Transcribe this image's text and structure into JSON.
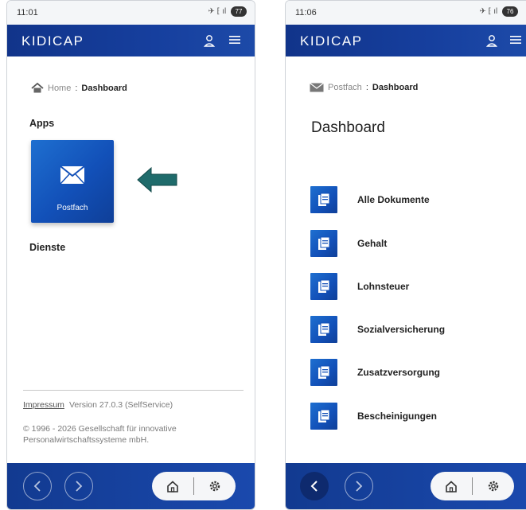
{
  "left_screen": {
    "status": {
      "time": "11:01",
      "icons": "✈ ⁅ ıl",
      "battery": "77"
    },
    "appbar": {
      "brand": "KIDICAP"
    },
    "breadcrumb": {
      "home": "Home",
      "separator": ":",
      "current": "Dashboard"
    },
    "apps_label": "Apps",
    "app_tile": {
      "label": "Postfach",
      "icon": "envelope-icon"
    },
    "services_label": "Dienste",
    "footer": {
      "impressum": "Impressum",
      "version": "Version 27.0.3 (SelfService)",
      "copyright_line1": "© 1996 - 2026 Gesellschaft für innovative",
      "copyright_line2": "Personalwirtschaftssysteme mbH."
    }
  },
  "right_screen": {
    "status": {
      "time": "11:06",
      "icons": "✈ ⁅ ıl",
      "battery": "76"
    },
    "appbar": {
      "brand": "KIDICAP"
    },
    "breadcrumb": {
      "home": "Postfach",
      "separator": ":",
      "current": "Dashboard"
    },
    "title": "Dashboard",
    "documents": [
      {
        "label": "Alle Dokumente"
      },
      {
        "label": "Gehalt"
      },
      {
        "label": "Lohnsteuer"
      },
      {
        "label": "Sozialversicherung"
      },
      {
        "label": "Zusatzversorgung"
      },
      {
        "label": "Bescheinigungen"
      }
    ]
  },
  "colors": {
    "appbar": "#11348a",
    "tile": "#1250b8",
    "arrow": "#1f6b6b"
  }
}
